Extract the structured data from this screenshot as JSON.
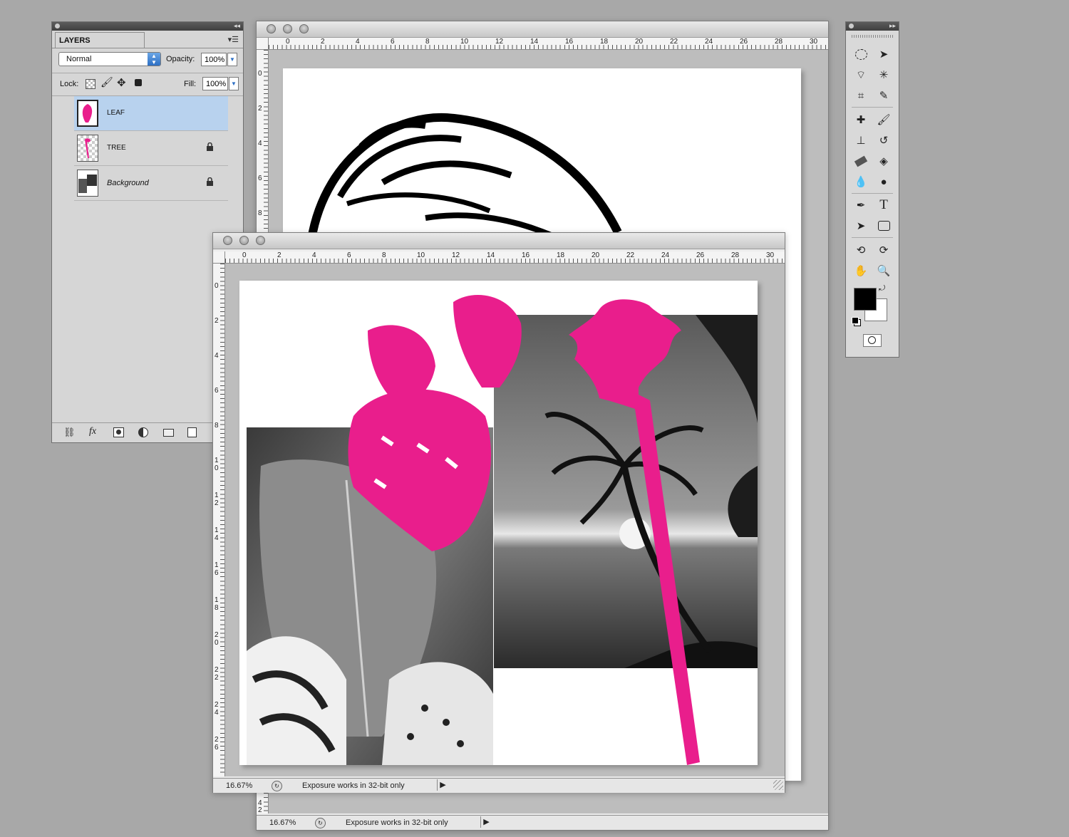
{
  "layers_panel": {
    "tab_label": "LAYERS",
    "blend_mode": "Normal",
    "opacity_label": "Opacity:",
    "opacity_value": "100%",
    "lock_label": "Lock:",
    "fill_label": "Fill:",
    "fill_value": "100%",
    "layers": [
      {
        "name": "LEAF",
        "selected": true,
        "locked": false
      },
      {
        "name": "TREE",
        "selected": false,
        "locked": true
      },
      {
        "name": "Background",
        "selected": false,
        "locked": true
      }
    ],
    "footer_icons": [
      "link-icon",
      "fx-icon",
      "mask-icon",
      "adjustment-icon",
      "folder-icon",
      "new-layer-icon"
    ]
  },
  "back_window": {
    "zoom": "16.67%",
    "status_text": "Exposure works in 32-bit only",
    "ruler_top": [
      "0",
      "2",
      "4",
      "6",
      "8",
      "10",
      "12",
      "14",
      "16",
      "18",
      "20",
      "22",
      "24",
      "26",
      "28",
      "30"
    ],
    "ruler_left": [
      "0",
      "2",
      "4",
      "6",
      "8"
    ],
    "ruler_left_bottom": [
      "4",
      "2"
    ]
  },
  "front_window": {
    "zoom": "16.67%",
    "status_text": "Exposure works in 32-bit only",
    "ruler_top": [
      "0",
      "2",
      "4",
      "6",
      "8",
      "10",
      "12",
      "14",
      "16",
      "18",
      "20",
      "22",
      "24",
      "26",
      "28",
      "30"
    ],
    "ruler_left": [
      "0",
      "2",
      "4",
      "6",
      "8",
      "10",
      "12",
      "14",
      "16",
      "18",
      "20",
      "22",
      "24",
      "26"
    ]
  },
  "toolbox": {
    "tools": [
      "marquee-icon",
      "move-icon",
      "lasso-icon",
      "magic-wand-icon",
      "crop-icon",
      "eyedropper-icon",
      "healing-icon",
      "brush-icon",
      "stamp-icon",
      "history-brush-icon",
      "eraser-icon",
      "paint-bucket-icon",
      "blur-icon",
      "dodge-icon",
      "pen-icon",
      "type-icon",
      "path-select-icon",
      "shape-icon",
      "3d-rotate-icon",
      "3d-orbit-icon",
      "hand-icon",
      "zoom-icon"
    ],
    "type_glyph": "T"
  },
  "colors": {
    "accent_pink": "#e91e8c",
    "selection_blue": "#b8d2ee",
    "foreground": "#000000",
    "background": "#ffffff"
  }
}
